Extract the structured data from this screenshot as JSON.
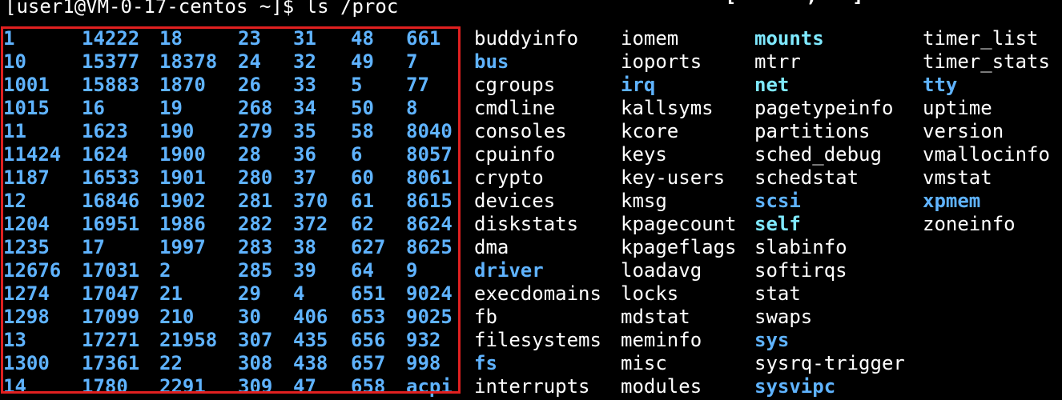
{
  "terminal": {
    "prompt": "[user1@VM-0-17-centos ~]$ ls /proc",
    "top_fragment": "[      ,   ]"
  },
  "colors": {
    "background": "#000000",
    "pid_blue": "#5fb3ff",
    "dir_blue": "#5fb3ff",
    "link_cyan": "#7fe9ff",
    "highlight_red": "#e02020"
  },
  "listing": {
    "rows": [
      [
        {
          "t": "1",
          "k": "pid"
        },
        {
          "t": "14222",
          "k": "pid"
        },
        {
          "t": "18",
          "k": "pid"
        },
        {
          "t": "23",
          "k": "pid"
        },
        {
          "t": "31",
          "k": "pid"
        },
        {
          "t": "48",
          "k": "pid"
        },
        {
          "t": "661",
          "k": "pid"
        },
        {
          "t": "buddyinfo",
          "k": "file"
        },
        {
          "t": "iomem",
          "k": "file"
        },
        {
          "t": "mounts",
          "k": "link"
        },
        {
          "t": "timer_list",
          "k": "file"
        }
      ],
      [
        {
          "t": "10",
          "k": "pid"
        },
        {
          "t": "15377",
          "k": "pid"
        },
        {
          "t": "18378",
          "k": "pid"
        },
        {
          "t": "24",
          "k": "pid"
        },
        {
          "t": "32",
          "k": "pid"
        },
        {
          "t": "49",
          "k": "pid"
        },
        {
          "t": "7",
          "k": "pid"
        },
        {
          "t": "bus",
          "k": "dir"
        },
        {
          "t": "ioports",
          "k": "file"
        },
        {
          "t": "mtrr",
          "k": "file"
        },
        {
          "t": "timer_stats",
          "k": "file"
        }
      ],
      [
        {
          "t": "1001",
          "k": "pid"
        },
        {
          "t": "15883",
          "k": "pid"
        },
        {
          "t": "1870",
          "k": "pid"
        },
        {
          "t": "26",
          "k": "pid"
        },
        {
          "t": "33",
          "k": "pid"
        },
        {
          "t": "5",
          "k": "pid"
        },
        {
          "t": "77",
          "k": "pid"
        },
        {
          "t": "cgroups",
          "k": "file"
        },
        {
          "t": "irq",
          "k": "dir"
        },
        {
          "t": "net",
          "k": "link"
        },
        {
          "t": "tty",
          "k": "dir"
        }
      ],
      [
        {
          "t": "1015",
          "k": "pid"
        },
        {
          "t": "16",
          "k": "pid"
        },
        {
          "t": "19",
          "k": "pid"
        },
        {
          "t": "268",
          "k": "pid"
        },
        {
          "t": "34",
          "k": "pid"
        },
        {
          "t": "50",
          "k": "pid"
        },
        {
          "t": "8",
          "k": "pid"
        },
        {
          "t": "cmdline",
          "k": "file"
        },
        {
          "t": "kallsyms",
          "k": "file"
        },
        {
          "t": "pagetypeinfo",
          "k": "file"
        },
        {
          "t": "uptime",
          "k": "file"
        }
      ],
      [
        {
          "t": "11",
          "k": "pid"
        },
        {
          "t": "1623",
          "k": "pid"
        },
        {
          "t": "190",
          "k": "pid"
        },
        {
          "t": "279",
          "k": "pid"
        },
        {
          "t": "35",
          "k": "pid"
        },
        {
          "t": "58",
          "k": "pid"
        },
        {
          "t": "8040",
          "k": "pid"
        },
        {
          "t": "consoles",
          "k": "file"
        },
        {
          "t": "kcore",
          "k": "file"
        },
        {
          "t": "partitions",
          "k": "file"
        },
        {
          "t": "version",
          "k": "file"
        }
      ],
      [
        {
          "t": "11424",
          "k": "pid"
        },
        {
          "t": "1624",
          "k": "pid"
        },
        {
          "t": "1900",
          "k": "pid"
        },
        {
          "t": "28",
          "k": "pid"
        },
        {
          "t": "36",
          "k": "pid"
        },
        {
          "t": "6",
          "k": "pid"
        },
        {
          "t": "8057",
          "k": "pid"
        },
        {
          "t": "cpuinfo",
          "k": "file"
        },
        {
          "t": "keys",
          "k": "file"
        },
        {
          "t": "sched_debug",
          "k": "file"
        },
        {
          "t": "vmallocinfo",
          "k": "file"
        }
      ],
      [
        {
          "t": "1187",
          "k": "pid"
        },
        {
          "t": "16533",
          "k": "pid"
        },
        {
          "t": "1901",
          "k": "pid"
        },
        {
          "t": "280",
          "k": "pid"
        },
        {
          "t": "37",
          "k": "pid"
        },
        {
          "t": "60",
          "k": "pid"
        },
        {
          "t": "8061",
          "k": "pid"
        },
        {
          "t": "crypto",
          "k": "file"
        },
        {
          "t": "key-users",
          "k": "file"
        },
        {
          "t": "schedstat",
          "k": "file"
        },
        {
          "t": "vmstat",
          "k": "file"
        }
      ],
      [
        {
          "t": "12",
          "k": "pid"
        },
        {
          "t": "16846",
          "k": "pid"
        },
        {
          "t": "1902",
          "k": "pid"
        },
        {
          "t": "281",
          "k": "pid"
        },
        {
          "t": "370",
          "k": "pid"
        },
        {
          "t": "61",
          "k": "pid"
        },
        {
          "t": "8615",
          "k": "pid"
        },
        {
          "t": "devices",
          "k": "file"
        },
        {
          "t": "kmsg",
          "k": "file"
        },
        {
          "t": "scsi",
          "k": "dir"
        },
        {
          "t": "xpmem",
          "k": "dir"
        }
      ],
      [
        {
          "t": "1204",
          "k": "pid"
        },
        {
          "t": "16951",
          "k": "pid"
        },
        {
          "t": "1986",
          "k": "pid"
        },
        {
          "t": "282",
          "k": "pid"
        },
        {
          "t": "372",
          "k": "pid"
        },
        {
          "t": "62",
          "k": "pid"
        },
        {
          "t": "8624",
          "k": "pid"
        },
        {
          "t": "diskstats",
          "k": "file"
        },
        {
          "t": "kpagecount",
          "k": "file"
        },
        {
          "t": "self",
          "k": "link"
        },
        {
          "t": "zoneinfo",
          "k": "file"
        }
      ],
      [
        {
          "t": "1235",
          "k": "pid"
        },
        {
          "t": "17",
          "k": "pid"
        },
        {
          "t": "1997",
          "k": "pid"
        },
        {
          "t": "283",
          "k": "pid"
        },
        {
          "t": "38",
          "k": "pid"
        },
        {
          "t": "627",
          "k": "pid"
        },
        {
          "t": "8625",
          "k": "pid"
        },
        {
          "t": "dma",
          "k": "file"
        },
        {
          "t": "kpageflags",
          "k": "file"
        },
        {
          "t": "slabinfo",
          "k": "file"
        },
        {
          "t": "",
          "k": "file"
        }
      ],
      [
        {
          "t": "12676",
          "k": "pid"
        },
        {
          "t": "17031",
          "k": "pid"
        },
        {
          "t": "2",
          "k": "pid"
        },
        {
          "t": "285",
          "k": "pid"
        },
        {
          "t": "39",
          "k": "pid"
        },
        {
          "t": "64",
          "k": "pid"
        },
        {
          "t": "9",
          "k": "pid"
        },
        {
          "t": "driver",
          "k": "dir"
        },
        {
          "t": "loadavg",
          "k": "file"
        },
        {
          "t": "softirqs",
          "k": "file"
        },
        {
          "t": "",
          "k": "file"
        }
      ],
      [
        {
          "t": "1274",
          "k": "pid"
        },
        {
          "t": "17047",
          "k": "pid"
        },
        {
          "t": "21",
          "k": "pid"
        },
        {
          "t": "29",
          "k": "pid"
        },
        {
          "t": "4",
          "k": "pid"
        },
        {
          "t": "651",
          "k": "pid"
        },
        {
          "t": "9024",
          "k": "pid"
        },
        {
          "t": "execdomains",
          "k": "file"
        },
        {
          "t": "locks",
          "k": "file"
        },
        {
          "t": "stat",
          "k": "file"
        },
        {
          "t": "",
          "k": "file"
        }
      ],
      [
        {
          "t": "1298",
          "k": "pid"
        },
        {
          "t": "17099",
          "k": "pid"
        },
        {
          "t": "210",
          "k": "pid"
        },
        {
          "t": "30",
          "k": "pid"
        },
        {
          "t": "406",
          "k": "pid"
        },
        {
          "t": "653",
          "k": "pid"
        },
        {
          "t": "9025",
          "k": "pid"
        },
        {
          "t": "fb",
          "k": "file"
        },
        {
          "t": "mdstat",
          "k": "file"
        },
        {
          "t": "swaps",
          "k": "file"
        },
        {
          "t": "",
          "k": "file"
        }
      ],
      [
        {
          "t": "13",
          "k": "pid"
        },
        {
          "t": "17271",
          "k": "pid"
        },
        {
          "t": "21958",
          "k": "pid"
        },
        {
          "t": "307",
          "k": "pid"
        },
        {
          "t": "435",
          "k": "pid"
        },
        {
          "t": "656",
          "k": "pid"
        },
        {
          "t": "932",
          "k": "pid"
        },
        {
          "t": "filesystems",
          "k": "file"
        },
        {
          "t": "meminfo",
          "k": "file"
        },
        {
          "t": "sys",
          "k": "dir"
        },
        {
          "t": "",
          "k": "file"
        }
      ],
      [
        {
          "t": "1300",
          "k": "pid"
        },
        {
          "t": "17361",
          "k": "pid"
        },
        {
          "t": "22",
          "k": "pid"
        },
        {
          "t": "308",
          "k": "pid"
        },
        {
          "t": "438",
          "k": "pid"
        },
        {
          "t": "657",
          "k": "pid"
        },
        {
          "t": "998",
          "k": "pid"
        },
        {
          "t": "fs",
          "k": "dir"
        },
        {
          "t": "misc",
          "k": "file"
        },
        {
          "t": "sysrq-trigger",
          "k": "file"
        },
        {
          "t": "",
          "k": "file"
        }
      ],
      [
        {
          "t": "14",
          "k": "pid"
        },
        {
          "t": "1780",
          "k": "pid"
        },
        {
          "t": "2291",
          "k": "pid"
        },
        {
          "t": "309",
          "k": "pid"
        },
        {
          "t": "47",
          "k": "pid"
        },
        {
          "t": "658",
          "k": "pid"
        },
        {
          "t": "acpi",
          "k": "dir"
        },
        {
          "t": "interrupts",
          "k": "file"
        },
        {
          "t": "modules",
          "k": "file"
        },
        {
          "t": "sysvipc",
          "k": "dir"
        },
        {
          "t": "",
          "k": "file"
        }
      ]
    ]
  }
}
